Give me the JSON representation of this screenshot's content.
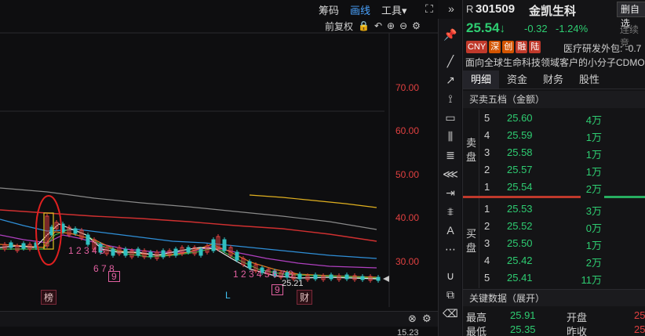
{
  "header": {
    "chouma": "筹码",
    "huaxian": "画线",
    "tools": "工具▾",
    "fuquan": "前复权"
  },
  "chart": {
    "price_ticks": [
      "70.00",
      "60.00",
      "50.00",
      "40.00",
      "30.00"
    ],
    "nums_left": "1 2 3 4 5",
    "nums_left_b": "6 7 8",
    "nums_right": "1 2 3 4 5 6 7 8",
    "label_9a": "9",
    "label_9b": "9",
    "min_marker": "25.21",
    "marker_bang": "榜",
    "marker_L": "L",
    "marker_cai": "财",
    "bottom_value": "15.23"
  },
  "stock": {
    "r_tag": "R",
    "code": "301509",
    "name": "金凯生科",
    "self_btn": "删自选",
    "price": "25.54",
    "arrow": "↓",
    "change": "-0.32",
    "change_pct": "-1.24%",
    "status": "连续竞",
    "tags": [
      "CNY",
      "深",
      "创",
      "融",
      "陆"
    ],
    "sector": "医疗研发外包: -0.7",
    "desc": "面向全球生命科技领域客户的小分子CDMO"
  },
  "tabs": [
    "明细",
    "资金",
    "财务",
    "股性"
  ],
  "orderbook": {
    "title": "买卖五档（金额）",
    "sell_label": "卖盘",
    "buy_label": "买盘",
    "sell": [
      {
        "lv": "5",
        "price": "25.60",
        "vol": "4万"
      },
      {
        "lv": "4",
        "price": "25.59",
        "vol": "1万"
      },
      {
        "lv": "3",
        "price": "25.58",
        "vol": "1万"
      },
      {
        "lv": "2",
        "price": "25.57",
        "vol": "1万"
      },
      {
        "lv": "1",
        "price": "25.54",
        "vol": "2万"
      }
    ],
    "buy": [
      {
        "lv": "1",
        "price": "25.53",
        "vol": "3万"
      },
      {
        "lv": "2",
        "price": "25.52",
        "vol": "0万"
      },
      {
        "lv": "3",
        "price": "25.50",
        "vol": "1万"
      },
      {
        "lv": "4",
        "price": "25.42",
        "vol": "2万"
      },
      {
        "lv": "5",
        "price": "25.41",
        "vol": "11万"
      }
    ]
  },
  "key_data": {
    "title": "关键数据（展开）",
    "rows": [
      {
        "l": "最高",
        "v": "25.91",
        "l2": "开盘",
        "v2": "25"
      },
      {
        "l": "最低",
        "v": "25.35",
        "l2": "昨收",
        "v2": "25"
      }
    ]
  },
  "colors": {
    "up": "#e04040",
    "down": "#2ecc71",
    "accent": "#4aa3ff"
  }
}
